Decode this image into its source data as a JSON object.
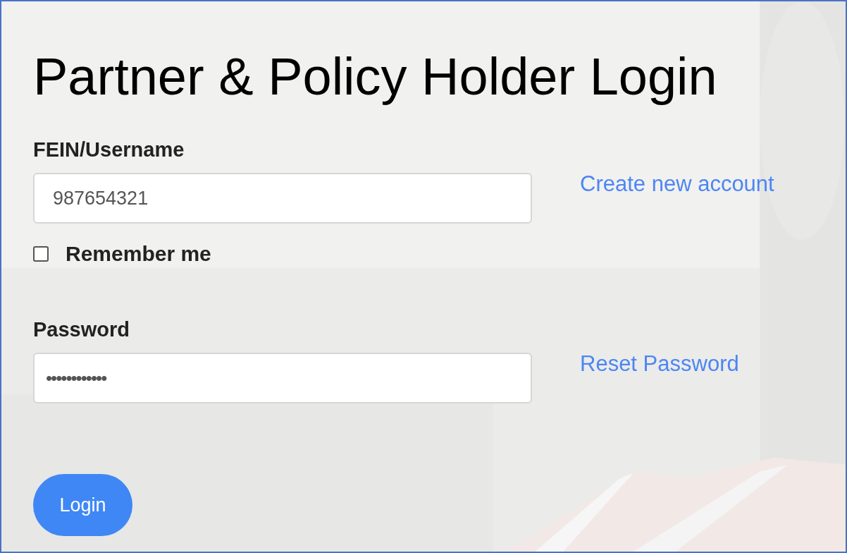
{
  "title": "Partner & Policy Holder Login",
  "fields": [
    {
      "label": "FEIN/Username",
      "value": "987654321",
      "link": "Create new account"
    },
    {
      "label": "Password",
      "value": "••••••••••••",
      "link": "Reset Password"
    }
  ],
  "remember": {
    "label": "Remember me",
    "checked": false
  },
  "login_button": "Login"
}
